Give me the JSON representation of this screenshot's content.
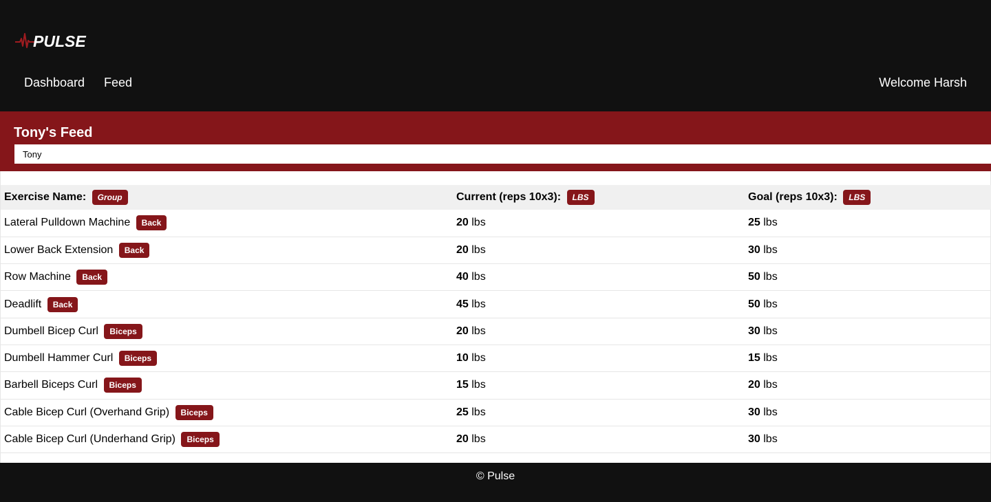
{
  "brand": {
    "name": "PULSE",
    "accent": "#85161a"
  },
  "nav": {
    "dashboard": "Dashboard",
    "feed": "Feed",
    "welcome": "Welcome Harsh"
  },
  "feed": {
    "title": "Tony's Feed",
    "search_value": "Tony"
  },
  "table": {
    "headers": {
      "exercise": "Exercise Name:",
      "exercise_badge": "Group",
      "current": "Current (reps 10x3):",
      "current_badge": "LBS",
      "goal": "Goal (reps 10x3):",
      "goal_badge": "LBS"
    },
    "unit": "lbs",
    "rows": [
      {
        "name": "Lateral Pulldown Machine",
        "group": "Back",
        "current": "20",
        "goal": "25"
      },
      {
        "name": "Lower Back Extension",
        "group": "Back",
        "current": "20",
        "goal": "30"
      },
      {
        "name": "Row Machine",
        "group": "Back",
        "current": "40",
        "goal": "50"
      },
      {
        "name": "Deadlift",
        "group": "Back",
        "current": "45",
        "goal": "50"
      },
      {
        "name": "Dumbell Bicep Curl",
        "group": "Biceps",
        "current": "20",
        "goal": "30"
      },
      {
        "name": "Dumbell Hammer Curl",
        "group": "Biceps",
        "current": "10",
        "goal": "15"
      },
      {
        "name": "Barbell Biceps Curl",
        "group": "Biceps",
        "current": "15",
        "goal": "20"
      },
      {
        "name": "Cable Bicep Curl (Overhand Grip)",
        "group": "Biceps",
        "current": "25",
        "goal": "30"
      },
      {
        "name": "Cable Bicep Curl (Underhand Grip)",
        "group": "Biceps",
        "current": "20",
        "goal": "30"
      }
    ]
  },
  "footer": {
    "text": "© Pulse"
  }
}
